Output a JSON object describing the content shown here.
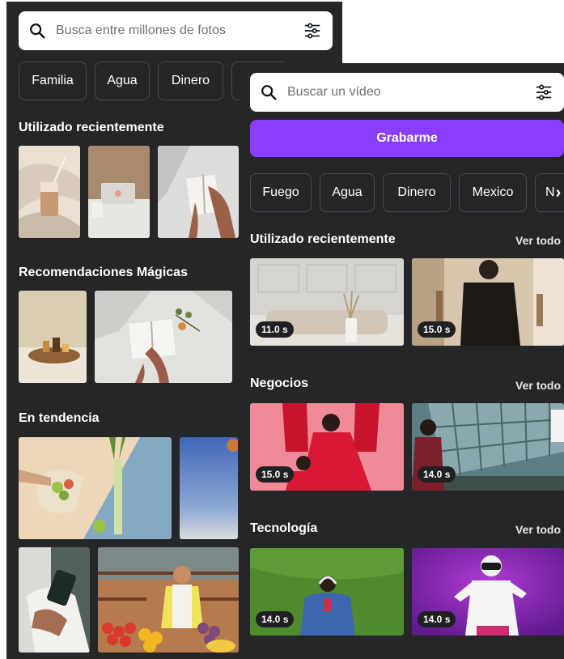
{
  "photos": {
    "search": {
      "placeholder": "Busca entre millones de fotos"
    },
    "chips": [
      "Familia",
      "Agua",
      "Dinero"
    ],
    "sections": {
      "recent": "Utilizado recientemente",
      "magic": "Recomendaciones Mágicas",
      "trending": "En tendencia"
    }
  },
  "videos": {
    "search": {
      "placeholder": "Buscar un vídeo"
    },
    "record_button": "Grabarme",
    "chips": [
      "Fuego",
      "Agua",
      "Dinero",
      "Mexico",
      "N"
    ],
    "chips_next": "›",
    "sections": [
      {
        "title": "Utilizado recientemente",
        "see_all": "Ver todo",
        "durations": [
          "11.0 s",
          "15.0 s"
        ]
      },
      {
        "title": "Negocios",
        "see_all": "Ver todo",
        "durations": [
          "15.0 s",
          "14.0 s"
        ]
      },
      {
        "title": "Tecnología",
        "see_all": "Ver todo",
        "durations": [
          "14.0 s",
          "14.0 s"
        ]
      }
    ]
  },
  "colors": {
    "panel_bg": "#252627",
    "accent": "#8b3dff",
    "chip_border": "#4a4c4f"
  },
  "icons": [
    "search-icon",
    "filter-icon",
    "chevron-right-icon"
  ]
}
